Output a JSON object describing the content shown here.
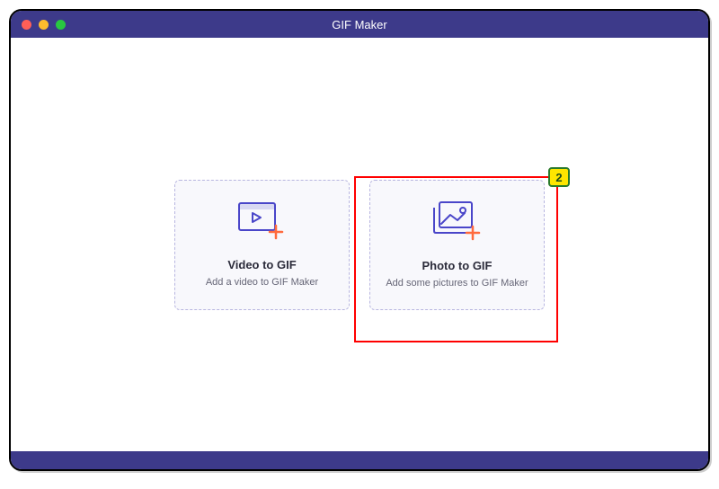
{
  "titlebar": {
    "title": "GIF Maker"
  },
  "cards": {
    "video": {
      "title": "Video to GIF",
      "subtitle": "Add a video to GIF Maker"
    },
    "photo": {
      "title": "Photo to GIF",
      "subtitle": "Add some pictures to GIF Maker"
    }
  },
  "annotation": {
    "badge": "2"
  },
  "colors": {
    "titlebar_bg": "#3d3a8a",
    "card_border": "#b8b6e0",
    "card_bg": "#f8f8fc",
    "icon_stroke": "#4a46c9",
    "plus_stroke": "#ff6a3d",
    "highlight": "#ff0000",
    "badge_bg": "#ffe600",
    "badge_border": "#2a7a2a"
  }
}
